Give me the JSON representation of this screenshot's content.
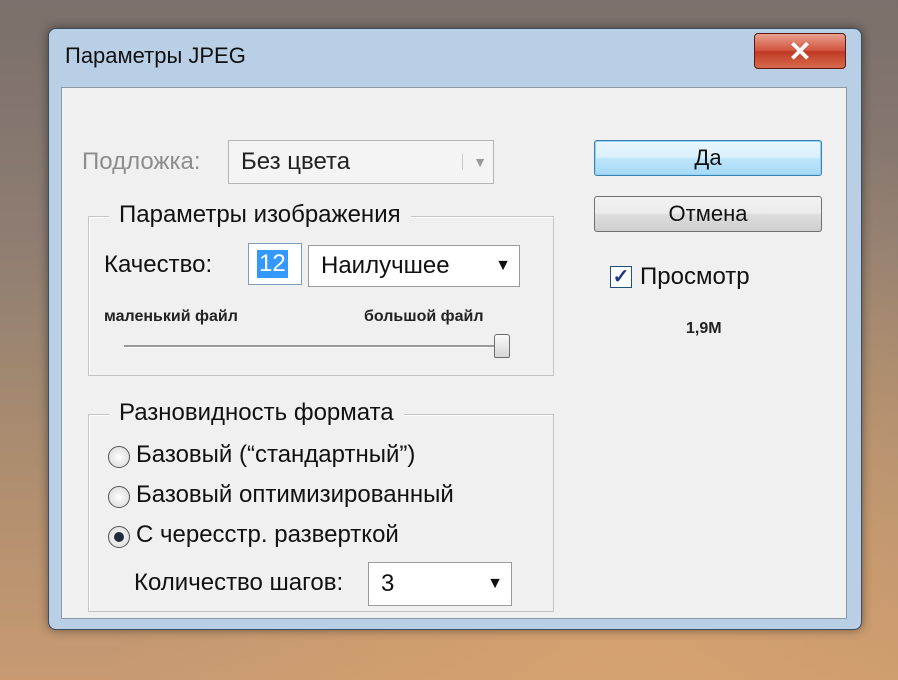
{
  "window": {
    "title": "Параметры JPEG",
    "close_glyph": "✕"
  },
  "matte": {
    "label": "Подложка:",
    "value": "Без цвета"
  },
  "image_options": {
    "legend": "Параметры изображения",
    "quality_label": "Качество:",
    "quality_value": "12",
    "quality_preset": "Наилучшее",
    "small_file_label": "маленький файл",
    "large_file_label": "большой файл",
    "slider_value_fraction": 1.0
  },
  "format_options": {
    "legend": "Разновидность формата",
    "options": [
      {
        "label": "Базовый (“стандартный”)",
        "selected": false
      },
      {
        "label": "Базовый оптимизированный",
        "selected": false
      },
      {
        "label": "С чересстр. разверткой",
        "selected": true
      }
    ],
    "scans_label": "Количество шагов:",
    "scans_value": "3"
  },
  "buttons": {
    "ok": "Да",
    "cancel": "Отмена"
  },
  "preview": {
    "label": "Просмотр",
    "checked": true,
    "check_glyph": "✓",
    "file_size": "1,9M"
  },
  "icons": {
    "dropdown": "▼"
  }
}
